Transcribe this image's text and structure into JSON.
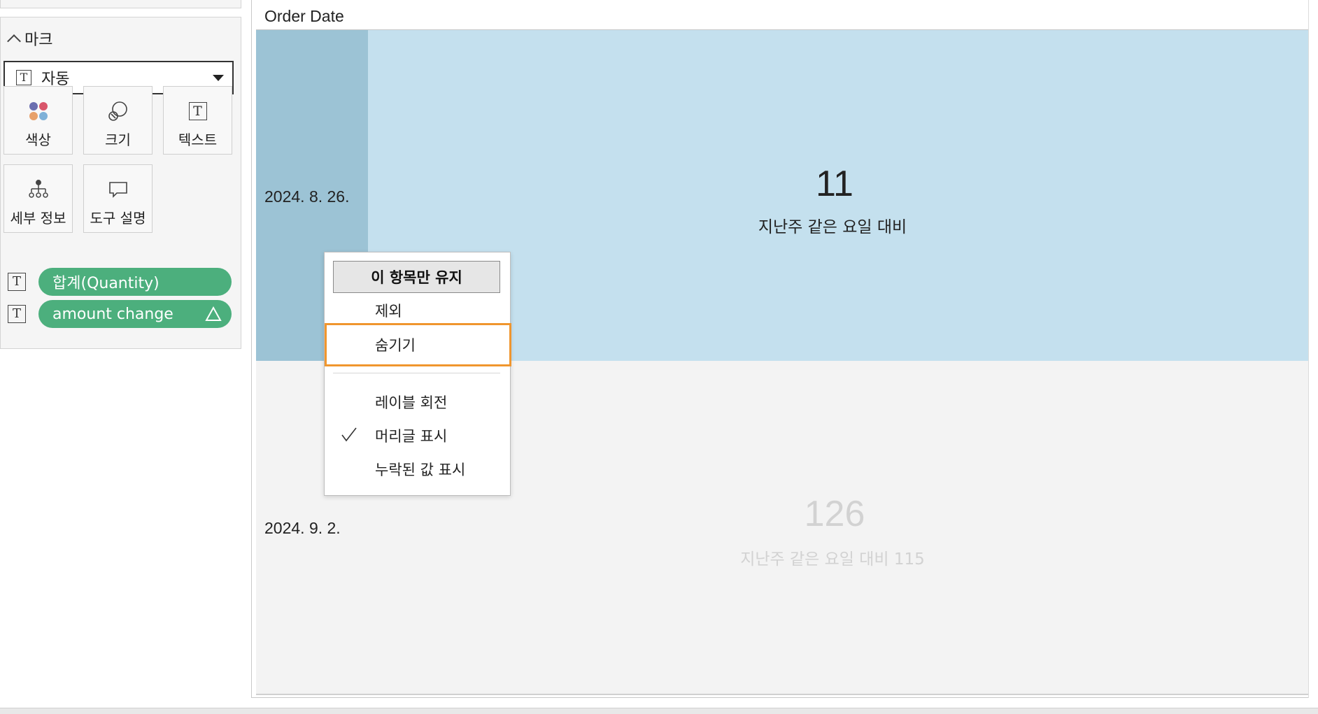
{
  "marks": {
    "header": "마크",
    "mark_type": "자동",
    "buttons": {
      "color": "색상",
      "size": "크기",
      "text": "텍스트",
      "detail": "세부 정보",
      "tooltip": "도구 설명"
    },
    "pills": [
      {
        "label": "합계(Quantity)",
        "color": "#4caf7d"
      },
      {
        "label": "amount change",
        "color": "#4caf7d"
      }
    ]
  },
  "view": {
    "column_header": "Order Date",
    "rows": [
      {
        "date": "2024. 8. 26.",
        "value": "11",
        "subtitle": "지난주 같은 요일 대비",
        "selected": true
      },
      {
        "date": "2024. 9. 2.",
        "value": "126",
        "subtitle": "지난주 같은 요일 대비 115",
        "selected": false
      }
    ]
  },
  "context_menu": {
    "keep_only": "이 항목만 유지",
    "exclude": "제외",
    "hide": "숨기기",
    "rotate_label": "레이블 회전",
    "show_header": "머리글 표시",
    "show_header_checked": true,
    "show_missing": "누락된 값 표시"
  },
  "colors": {
    "selected_header": "#9cc3d5",
    "selected_cell": "#c4e0ee",
    "highlight_border": "#f0962e",
    "pill_green": "#4caf7d"
  }
}
